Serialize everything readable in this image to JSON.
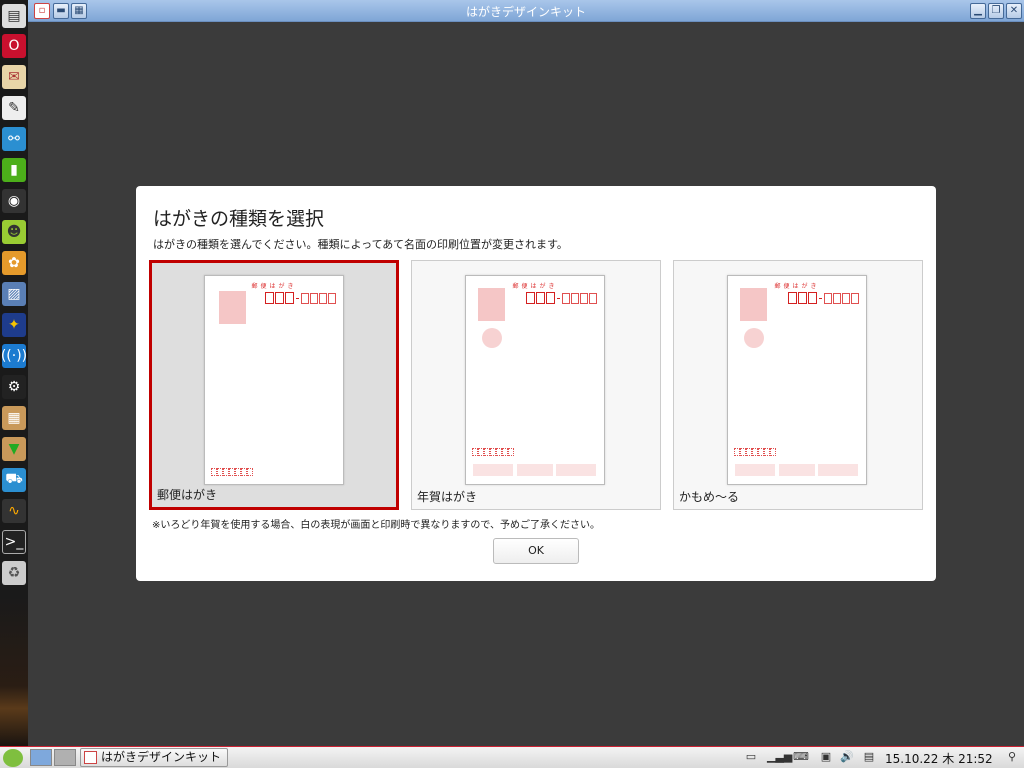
{
  "window": {
    "title": "はがきデザインキット"
  },
  "dialog": {
    "title": "はがきの種類を選択",
    "description": "はがきの種類を選んでください。種類によってあて名面の印刷位置が変更されます。",
    "note": "※いろどり年賀を使用する場合、白の表現が画面と印刷時で異なりますので、予めご了承ください。",
    "ok_label": "OK",
    "cards": [
      {
        "label": "郵便はがき",
        "header": "郵便はがき",
        "selected": true
      },
      {
        "label": "年賀はがき",
        "header": "郵便はがき",
        "selected": false
      },
      {
        "label": "かもめ〜る",
        "header": "郵便はがき",
        "selected": false
      }
    ]
  },
  "taskbar": {
    "task_label": "はがきデザインキット",
    "clock": "15.10.22 木 21:52"
  },
  "colors": {
    "accent": "#c00000",
    "title_bar": "#8fb2de"
  }
}
